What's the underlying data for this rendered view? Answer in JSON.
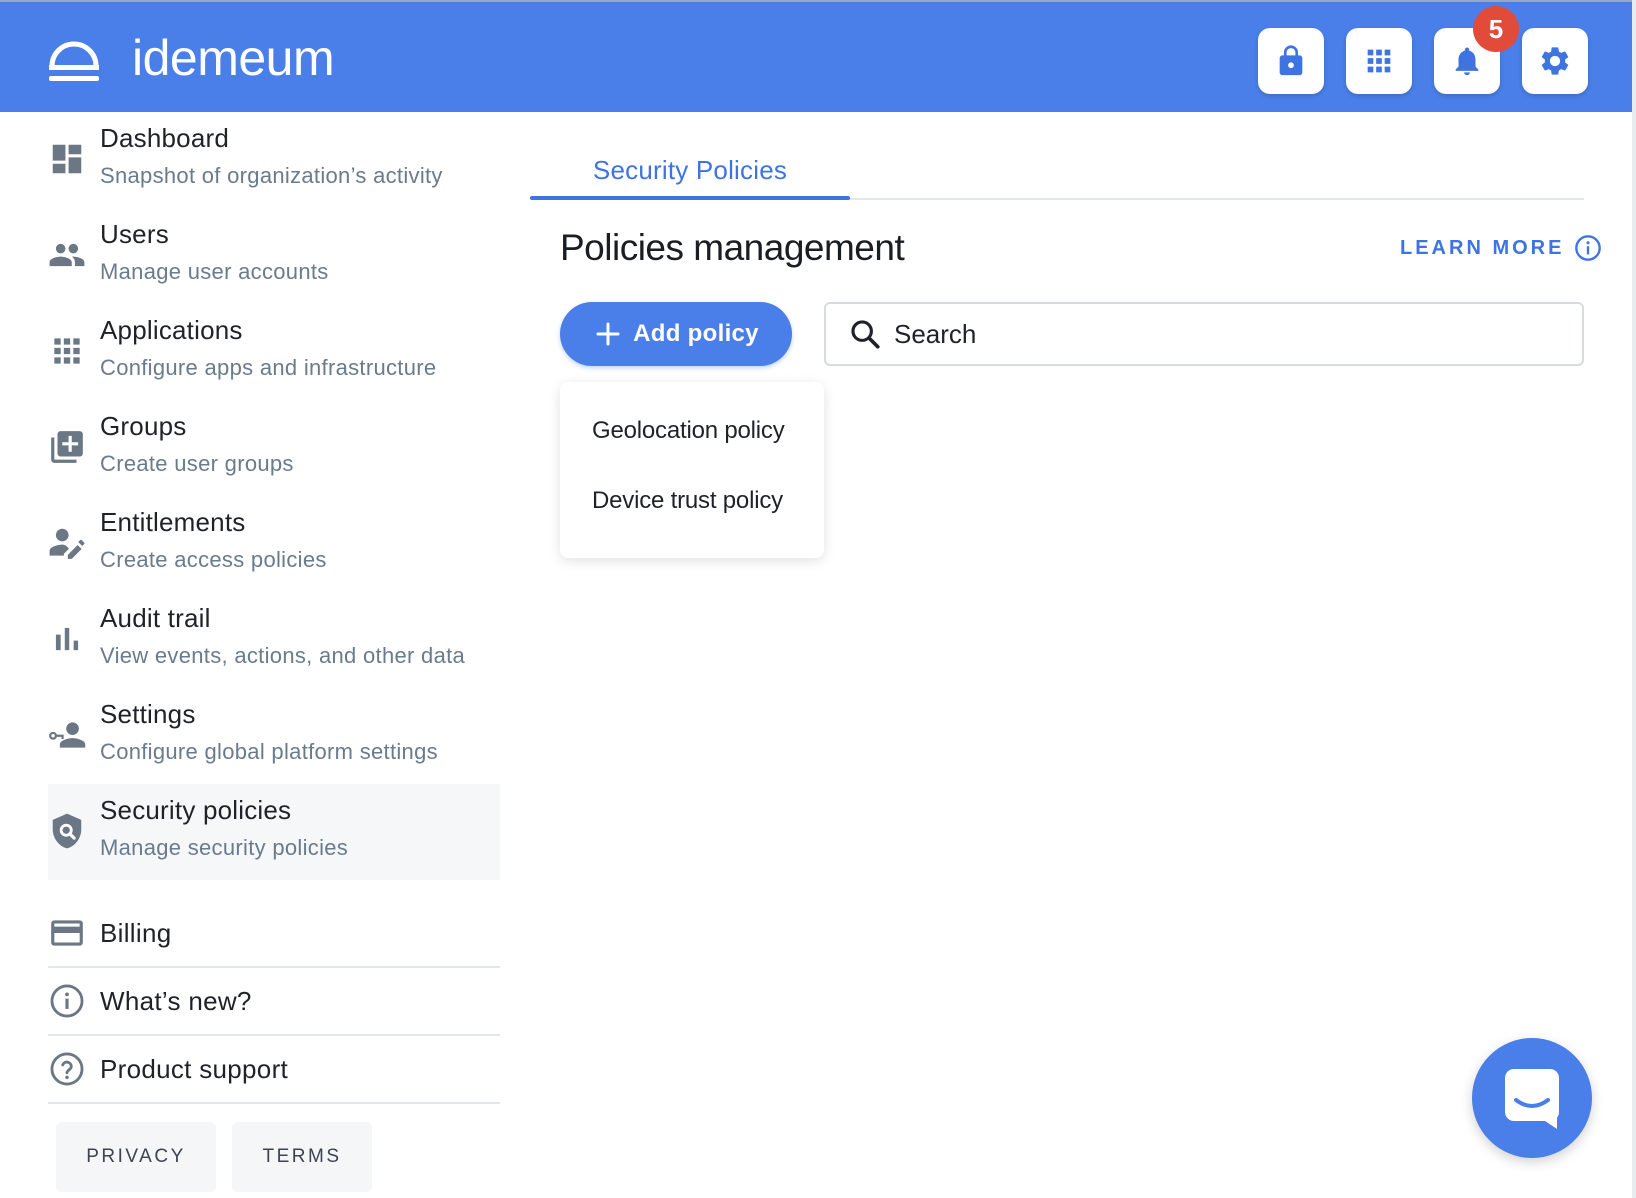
{
  "header": {
    "brand_name": "idemeum",
    "buttons": [
      "lock-icon",
      "apps-grid-icon",
      "bell-icon",
      "gear-icon"
    ],
    "notification_count": "5",
    "background_color": "#4a7ee8"
  },
  "sidebar": {
    "items": [
      {
        "title": "Dashboard",
        "subtitle": "Snapshot of organization’s activity",
        "icon": "dashboard-icon"
      },
      {
        "title": "Users",
        "subtitle": "Manage user accounts",
        "icon": "users-icon"
      },
      {
        "title": "Applications",
        "subtitle": "Configure apps and infrastructure",
        "icon": "apps-grid-icon"
      },
      {
        "title": "Groups",
        "subtitle": "Create user groups",
        "icon": "add-group-icon"
      },
      {
        "title": "Entitlements",
        "subtitle": "Create access policies",
        "icon": "user-edit-icon"
      },
      {
        "title": "Audit trail",
        "subtitle": "View events, actions, and other data",
        "icon": "bar-chart-icon"
      },
      {
        "title": "Settings",
        "subtitle": "Configure global platform settings",
        "icon": "user-key-icon"
      },
      {
        "title": "Security policies",
        "subtitle": "Manage security policies",
        "icon": "shield-search-icon",
        "active": true
      }
    ],
    "links": [
      {
        "label": "Billing",
        "icon": "credit-card-icon"
      },
      {
        "label": "What’s new?",
        "icon": "info-icon"
      },
      {
        "label": "Product support",
        "icon": "help-icon"
      }
    ],
    "footer": {
      "privacy": "PRIVACY",
      "terms": "TERMS"
    }
  },
  "main": {
    "tab": "Security Policies",
    "title": "Policies management",
    "learn_more": "LEARN MORE",
    "add_button": "Add policy",
    "search_placeholder": "Search",
    "dropdown": [
      "Geolocation policy",
      "Device trust policy"
    ],
    "accent_color": "#3f74e0"
  },
  "chat": {
    "icon": "chat-icon"
  }
}
